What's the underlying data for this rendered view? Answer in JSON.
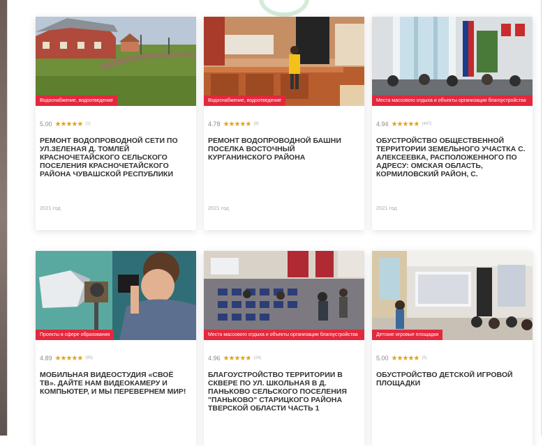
{
  "cards": [
    {
      "category": "Водоснабжение, водоотведение",
      "score": "5.00",
      "stars": "★★★★★",
      "count": "(1)",
      "title": "Ремонт водопроводной сети по ул.Зеленая д. Томлей Красночетайского сельского поселения Красночетайского района Чувашской Республики",
      "year": "2021 год"
    },
    {
      "category": "Водоснабжение, водоотведение",
      "score": "4.78",
      "stars": "★★★★★",
      "count": "(9)",
      "title": "Ремонт водопроводной башни поселка Восточный Курганинского района",
      "year": "2021 год"
    },
    {
      "category": "Места массового отдыха и объекты организации благоустройства",
      "score": "4.94",
      "stars": "★★★★★",
      "count": "(447)",
      "title": "Обустройство общественной территории Земельного участка с. Алексеевка, расположенного по адресу: Омская область, Кормиловский район, с.",
      "year": "2021 год"
    },
    {
      "category": "Проекты в сфере образования",
      "score": "4.89",
      "stars": "★★★★★",
      "count": "(95)",
      "title": "Мобильная видеостудия «Своё ТВ». Дайте нам видеокамеру и компьютер, и мы перевернем мир!",
      "year": ""
    },
    {
      "category": "Места массового отдыха и объекты организации благоустройства",
      "score": "4.96",
      "stars": "★★★★★",
      "count": "(24)",
      "title": "Благоустройство территории в сквере по ул. Школьная в д. Паньково Сельского поселения \"Паньково\" Старицкого района Тверской области часть 1",
      "year": ""
    },
    {
      "category": "Детские игровые площадки",
      "score": "5.00",
      "stars": "★★★★★",
      "count": "(5)",
      "title": "Обустройство детской игровой площадки",
      "year": ""
    }
  ]
}
